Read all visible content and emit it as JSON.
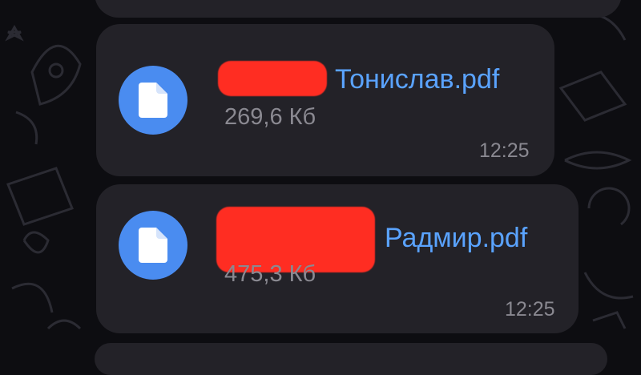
{
  "messages": [
    {
      "file_name_visible": "Тонислав.pdf",
      "file_size": "269,6 Кб",
      "time": "12:25",
      "icon": "document-icon"
    },
    {
      "file_name_visible": "Радмир.pdf",
      "file_size": "475,3 Кб",
      "time": "12:25",
      "icon": "document-icon"
    }
  ],
  "colors": {
    "background": "#0d0d11",
    "bubble": "#232228",
    "accent": "#4a8cf0",
    "link": "#5aa3ff",
    "meta": "#8a8991",
    "redaction": "#ff2d22"
  }
}
